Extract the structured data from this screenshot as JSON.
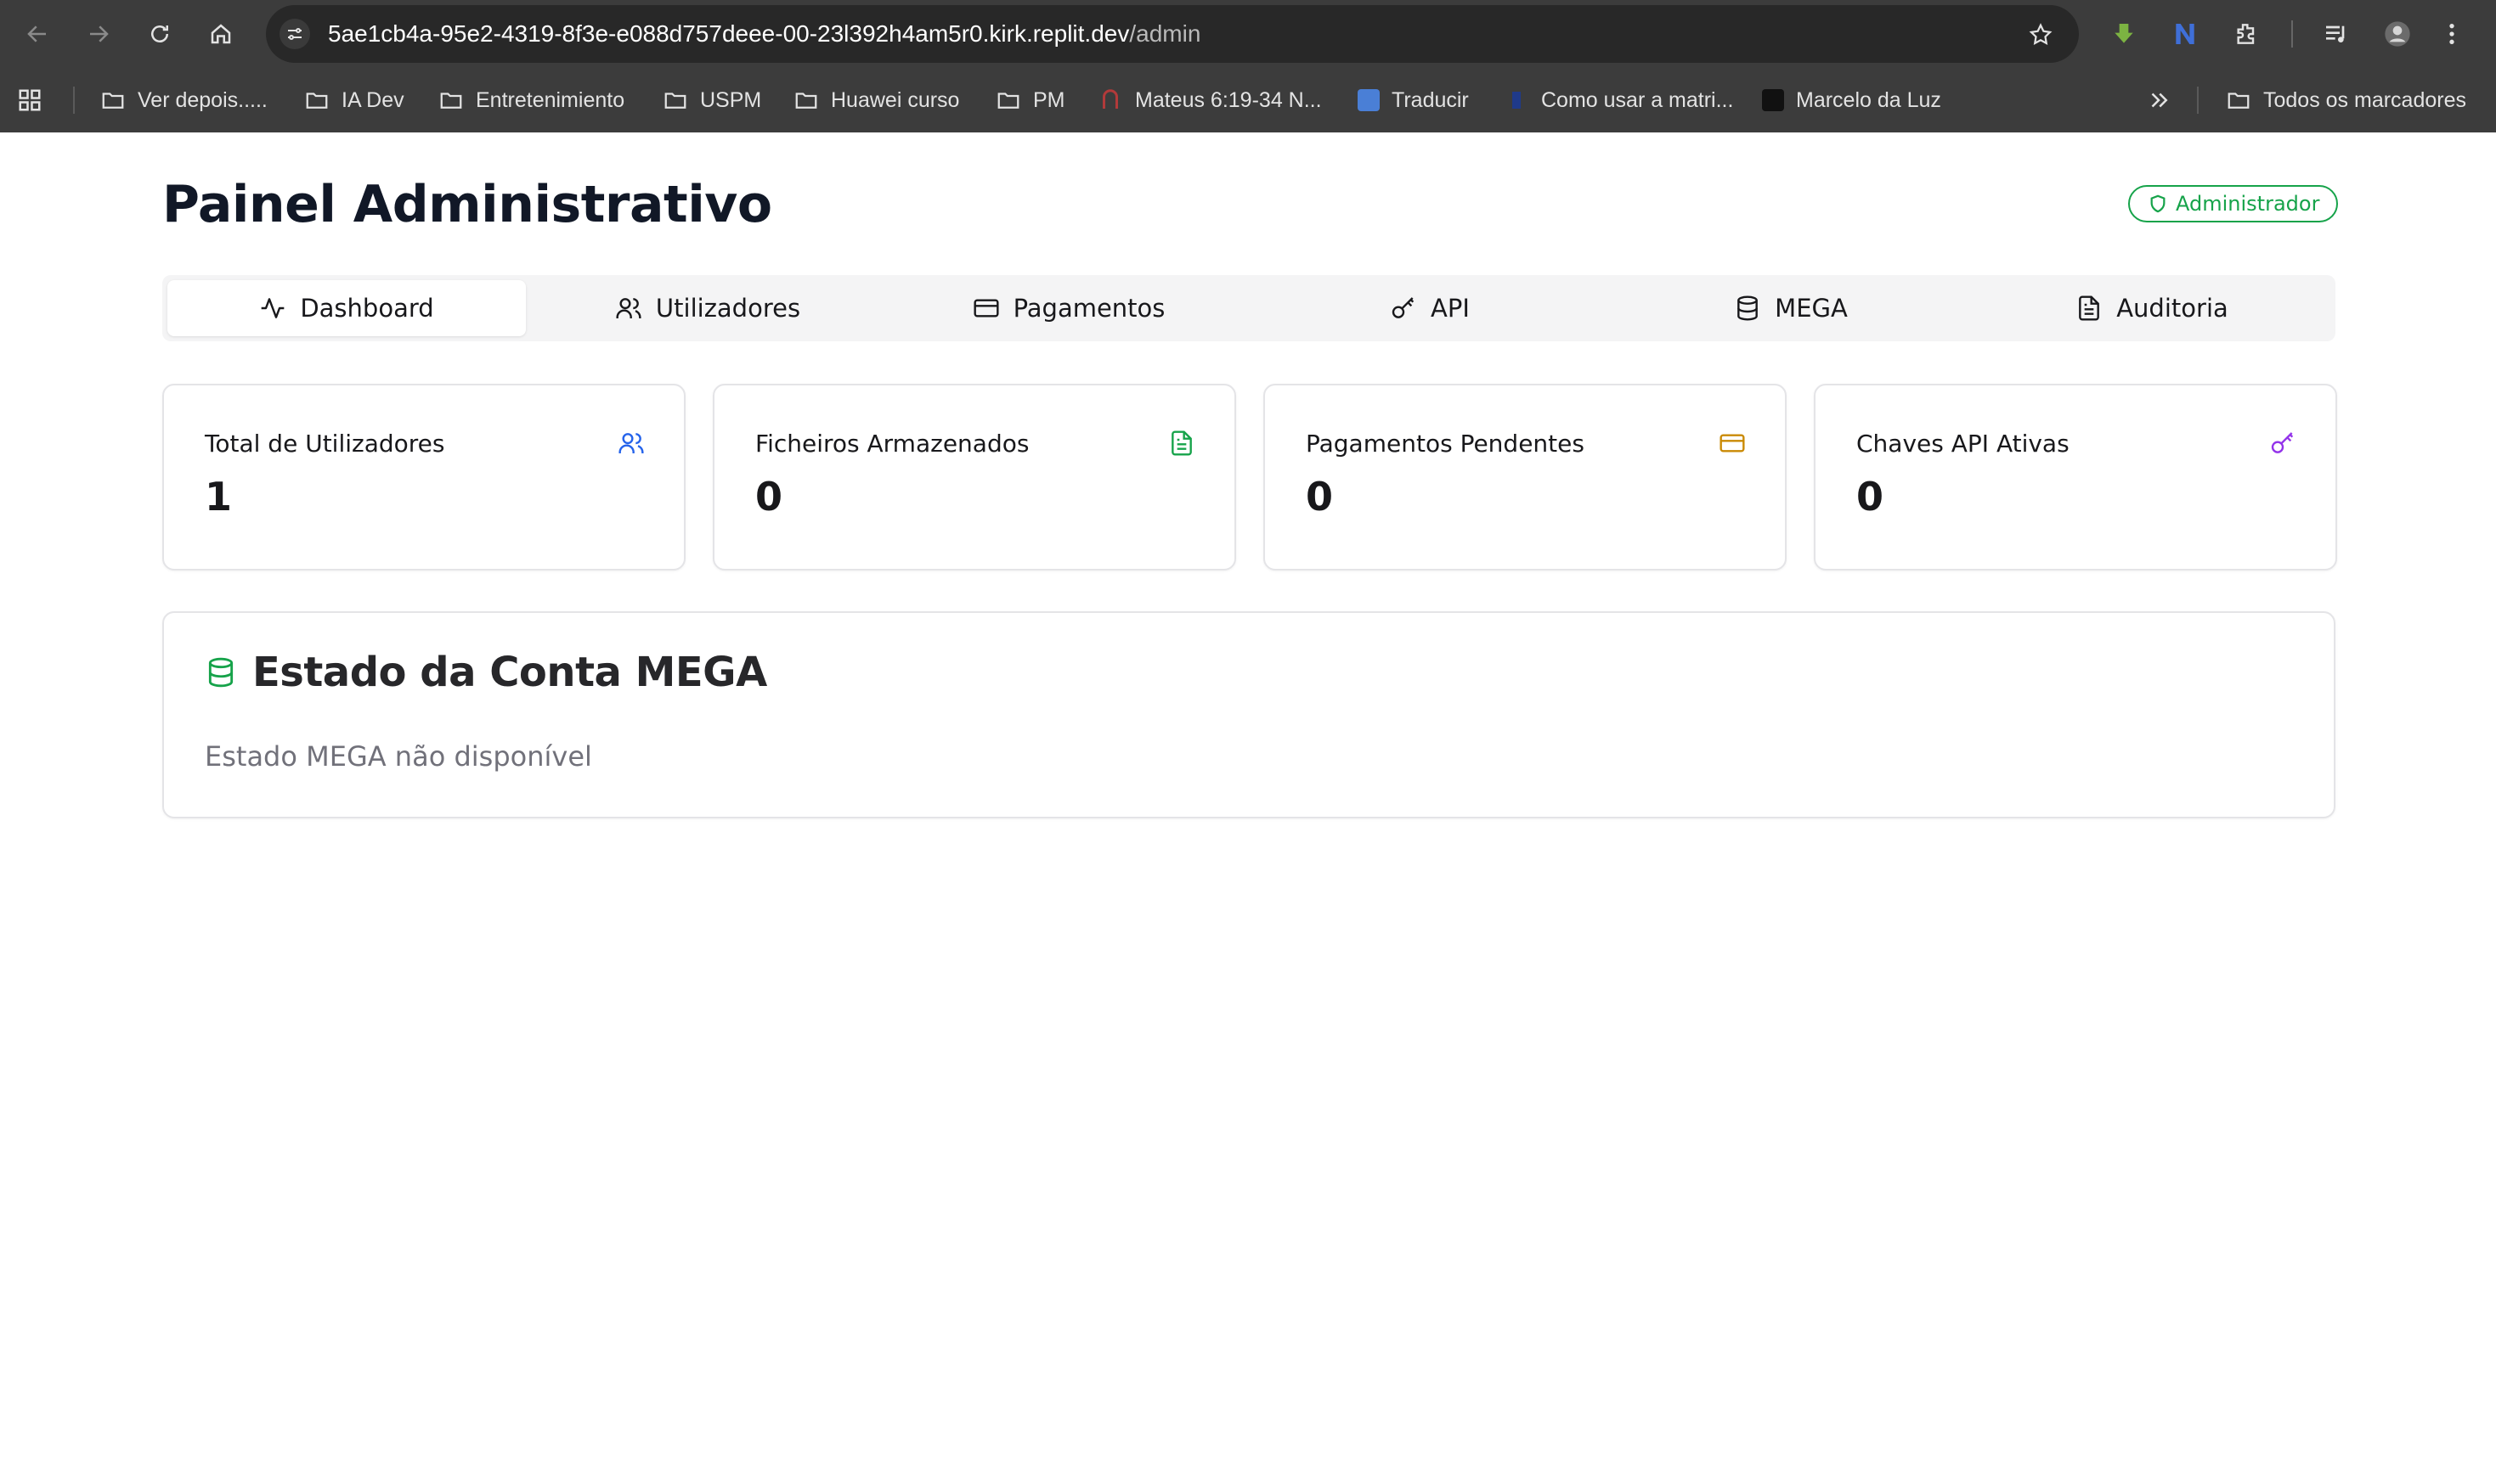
{
  "browser": {
    "url_host": "5ae1cb4a-95e2-4319-8f3e-e088d757deee-00-23l392h4am5r0.kirk.replit.dev",
    "url_path": "/admin",
    "bookmarks": [
      {
        "label": "Ver depois.....",
        "icon": "folder-icon"
      },
      {
        "label": "IA Dev",
        "icon": "folder-icon"
      },
      {
        "label": "Entretenimiento",
        "icon": "folder-icon"
      },
      {
        "label": "USPM",
        "icon": "folder-icon"
      },
      {
        "label": "Huawei curso",
        "icon": "folder-icon"
      },
      {
        "label": "PM",
        "icon": "folder-icon"
      },
      {
        "label": "Mateus 6:19-34 N...",
        "icon": "site-favicon"
      },
      {
        "label": "Traducir",
        "icon": "translate-favicon"
      },
      {
        "label": "Como usar a matri...",
        "icon": "site-favicon"
      },
      {
        "label": "Marcelo da Luz",
        "icon": "site-favicon"
      }
    ],
    "all_bookmarks": "Todos os marcadores"
  },
  "page": {
    "title": "Painel Administrativo",
    "role_badge": "Administrador"
  },
  "tabs": [
    {
      "label": "Dashboard",
      "icon": "activity-icon",
      "active": true
    },
    {
      "label": "Utilizadores",
      "icon": "users-icon",
      "active": false
    },
    {
      "label": "Pagamentos",
      "icon": "credit-card-icon",
      "active": false
    },
    {
      "label": "API",
      "icon": "key-icon",
      "active": false
    },
    {
      "label": "MEGA",
      "icon": "database-icon",
      "active": false
    },
    {
      "label": "Auditoria",
      "icon": "file-text-icon",
      "active": false
    }
  ],
  "stats": [
    {
      "label": "Total de Utilizadores",
      "value": "1",
      "icon": "users-icon",
      "color": "#2563eb"
    },
    {
      "label": "Ficheiros Armazenados",
      "value": "0",
      "icon": "file-text-icon",
      "color": "#16a34a"
    },
    {
      "label": "Pagamentos Pendentes",
      "value": "0",
      "icon": "credit-card-icon",
      "color": "#ca8a04"
    },
    {
      "label": "Chaves API Ativas",
      "value": "0",
      "icon": "key-icon",
      "color": "#9333ea"
    }
  ],
  "mega": {
    "title": "Estado da Conta MEGA",
    "status_text": "Estado MEGA não disponível",
    "icon_color": "#16a34a"
  },
  "colors": {
    "chrome_bg": "#3c3c3c",
    "badge_green": "#16a34a"
  }
}
